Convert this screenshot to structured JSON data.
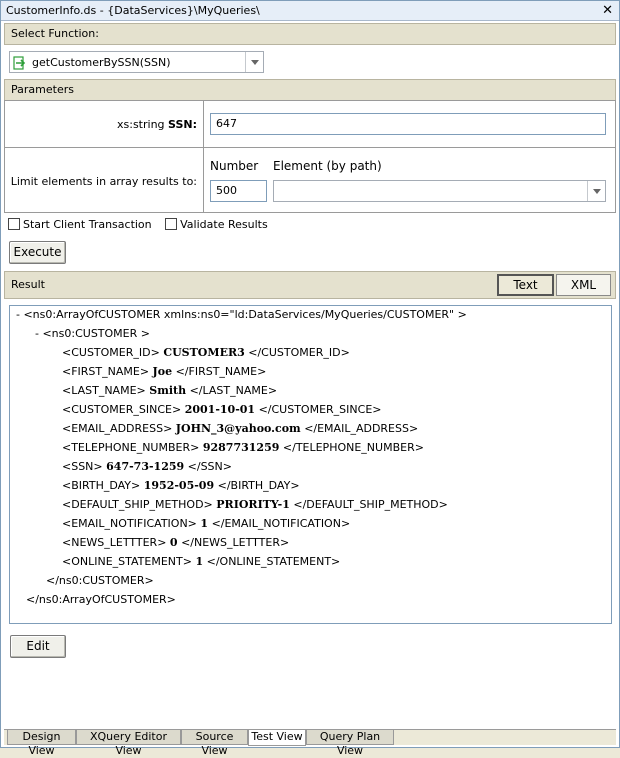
{
  "window": {
    "title": "CustomerInfo.ds - {DataServices}\\MyQueries\\",
    "close_glyph": "✕"
  },
  "select_function": {
    "header": "Select Function:",
    "value": "getCustomerBySSN(SSN)"
  },
  "parameters": {
    "header": "Parameters",
    "ssn_type": "xs:string",
    "ssn_label": "SSN:",
    "ssn_value": "647",
    "limit_label": "Limit elements in array results to:",
    "number_label": "Number",
    "number_value": "500",
    "element_label": "Element (by path)",
    "element_value": ""
  },
  "options": {
    "start_client_transaction": "Start Client Transaction",
    "validate_results": "Validate Results"
  },
  "buttons": {
    "execute": "Execute",
    "edit": "Edit",
    "text": "Text",
    "xml": "XML"
  },
  "result": {
    "header": "Result",
    "lines": [
      {
        "prefix": "-  <ns0:ArrayOfCUSTOMER xmlns:ns0=\"ld:DataServices/MyQueries/CUSTOMER\" >",
        "value": "",
        "suffix": ""
      },
      {
        "prefix": "-  <ns0:CUSTOMER >",
        "value": "",
        "suffix": ""
      },
      {
        "prefix": "<CUSTOMER_ID>",
        "value": "CUSTOMER3",
        "suffix": "</CUSTOMER_ID>"
      },
      {
        "prefix": "<FIRST_NAME>",
        "value": "Joe",
        "suffix": "</FIRST_NAME>"
      },
      {
        "prefix": "<LAST_NAME>",
        "value": "Smith",
        "suffix": "</LAST_NAME>"
      },
      {
        "prefix": "<CUSTOMER_SINCE>",
        "value": "2001-10-01",
        "suffix": "</CUSTOMER_SINCE>"
      },
      {
        "prefix": "<EMAIL_ADDRESS>",
        "value": "JOHN_3@yahoo.com",
        "suffix": "</EMAIL_ADDRESS>"
      },
      {
        "prefix": "<TELEPHONE_NUMBER>",
        "value": "9287731259",
        "suffix": "</TELEPHONE_NUMBER>"
      },
      {
        "prefix": "<SSN>",
        "value": "647-73-1259",
        "suffix": "</SSN>"
      },
      {
        "prefix": "<BIRTH_DAY>",
        "value": "1952-05-09",
        "suffix": "</BIRTH_DAY>"
      },
      {
        "prefix": "<DEFAULT_SHIP_METHOD>",
        "value": "PRIORITY-1",
        "suffix": "</DEFAULT_SHIP_METHOD>"
      },
      {
        "prefix": "<EMAIL_NOTIFICATION>",
        "value": "1",
        "suffix": "</EMAIL_NOTIFICATION>"
      },
      {
        "prefix": "<NEWS_LETTTER>",
        "value": "0",
        "suffix": "</NEWS_LETTTER>"
      },
      {
        "prefix": "<ONLINE_STATEMENT>",
        "value": "1",
        "suffix": "</ONLINE_STATEMENT>"
      },
      {
        "prefix": "</ns0:CUSTOMER>",
        "value": "",
        "suffix": ""
      },
      {
        "prefix": "</ns0:ArrayOfCUSTOMER>",
        "value": "",
        "suffix": ""
      }
    ]
  },
  "tabs": [
    {
      "label": "Design View",
      "active": false
    },
    {
      "label": "XQuery Editor View",
      "active": false
    },
    {
      "label": "Source View",
      "active": false
    },
    {
      "label": "Test View",
      "active": true
    },
    {
      "label": "Query Plan View",
      "active": false
    }
  ],
  "colors": {
    "section_header_bg": "#e4e1ce",
    "field_border": "#7f9db9",
    "function_icon_green": "#2e9e3a"
  },
  "icons": {
    "function": "function-arrow-icon",
    "dropdown": "chevron-down-icon"
  }
}
